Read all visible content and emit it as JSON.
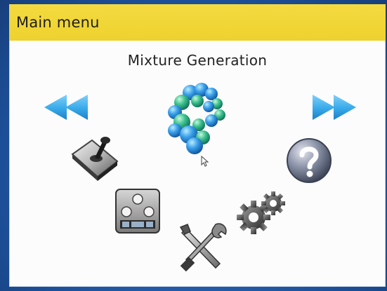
{
  "window": {
    "title": "Main menu"
  },
  "menu": {
    "current_item": "Mixture Generation",
    "items": [
      {
        "icon": "molecule-icon",
        "name": "Mixture Generation"
      },
      {
        "icon": "joystick-icon"
      },
      {
        "icon": "help-icon"
      },
      {
        "icon": "control-panel-icon"
      },
      {
        "icon": "gears-icon"
      },
      {
        "icon": "tools-icon"
      }
    ]
  },
  "nav": {
    "prev_icon": "rewind-icon",
    "next_icon": "fast-forward-icon"
  },
  "colors": {
    "titlebar": "#f0d534",
    "frame": "#1f5aa8",
    "arrow": "#35a8e8",
    "molecule": "#2e8ee0"
  }
}
